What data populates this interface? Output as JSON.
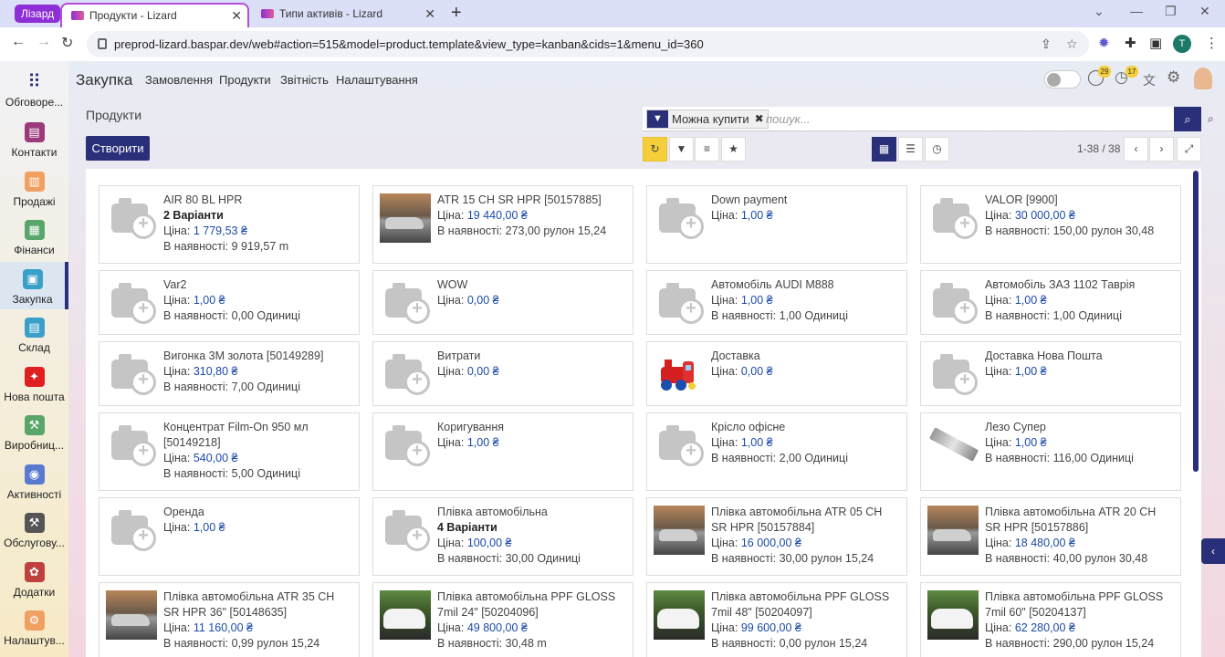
{
  "browser": {
    "profile": "Лізард",
    "tabs": [
      {
        "title": "Продукти - Lizard",
        "active": true
      },
      {
        "title": "Типи активів - Lizard",
        "active": false
      }
    ],
    "url": "preprod-lizard.baspar.dev/web#action=515&model=product.template&view_type=kanban&cids=1&menu_id=360",
    "avatar_letter": "T"
  },
  "sidebar": {
    "items": [
      {
        "label": "Обговоре...",
        "icon": "apps-grid-icon",
        "color": "#2a2f7a"
      },
      {
        "label": "Контакти",
        "icon": "contacts-icon",
        "color": "#9b3a7a"
      },
      {
        "label": "Продажі",
        "icon": "sales-icon",
        "color": "#f0a060"
      },
      {
        "label": "Фінанси",
        "icon": "finance-icon",
        "color": "#5aa66a"
      },
      {
        "label": "Закупка",
        "icon": "purchase-icon",
        "color": "#3aa0c8"
      },
      {
        "label": "Склад",
        "icon": "warehouse-icon",
        "color": "#3aa0c8"
      },
      {
        "label": "Нова пошта",
        "icon": "nova-poshta-icon",
        "color": "#e02020"
      },
      {
        "label": "Виробниц...",
        "icon": "manufacturing-icon",
        "color": "#5aa66a"
      },
      {
        "label": "Активності",
        "icon": "activities-icon",
        "color": "#5a7ad0"
      },
      {
        "label": "Обслугову...",
        "icon": "maintenance-icon",
        "color": "#555"
      },
      {
        "label": "Додатки",
        "icon": "apps-icon",
        "color": "#c04040"
      },
      {
        "label": "Налаштув...",
        "icon": "settings-icon",
        "color": "#f0a060"
      }
    ]
  },
  "topnav": {
    "app_title": "Закупка",
    "menu": [
      "Замовлення",
      "Продукти",
      "Звітність",
      "Налаштування"
    ],
    "chat_badge": "29",
    "activity_badge": "17"
  },
  "page": {
    "title": "Продукти",
    "create_label": "Створити",
    "search": {
      "facet": "Можна купити",
      "placeholder": "пошук..."
    },
    "pager": "1-38 / 38"
  },
  "products": [
    {
      "name": "AIR 80 BL HPR",
      "variants": "2 Варіанти",
      "price_label": "Ціна:",
      "price": "1 779,53 ₴",
      "stock": "В наявності: 9 919,57 m",
      "image": "placeholder"
    },
    {
      "name": "ATR 15 CH SR HPR [50157885]",
      "price_label": "Ціна:",
      "price": "19 440,00 ₴",
      "stock": "В наявності: 273,00 рулон 15,24",
      "image": "car-dark"
    },
    {
      "name": "Down payment",
      "price_label": "Ціна:",
      "price": "1,00 ₴",
      "image": "placeholder"
    },
    {
      "name": "VALOR [9900]",
      "price_label": "Ціна:",
      "price": "30 000,00 ₴",
      "stock": "В наявності: 150,00 рулон 30,48",
      "image": "placeholder"
    },
    {
      "name": "Var2",
      "price_label": "Ціна:",
      "price": "1,00 ₴",
      "stock": "В наявності: 0,00 Одиниці",
      "image": "placeholder"
    },
    {
      "name": "WOW",
      "price_label": "Ціна:",
      "price": "0,00 ₴",
      "image": "placeholder"
    },
    {
      "name": "Автомобіль AUDI M888",
      "price_label": "Ціна:",
      "price": "1,00 ₴",
      "stock": "В наявності: 1,00 Одиниці",
      "image": "placeholder"
    },
    {
      "name": "Автомобіль ЗАЗ 1102 Таврія",
      "price_label": "Ціна:",
      "price": "1,00 ₴",
      "stock": "В наявності: 1,00 Одиниці",
      "image": "placeholder"
    },
    {
      "name": "Вигонка 3М золота [50149289]",
      "price_label": "Ціна:",
      "price": "310,80 ₴",
      "stock": "В наявності: 7,00 Одиниці",
      "image": "placeholder"
    },
    {
      "name": "Витрати",
      "price_label": "Ціна:",
      "price": "0,00 ₴",
      "image": "placeholder"
    },
    {
      "name": "Доставка",
      "price_label": "Ціна:",
      "price": "0,00 ₴",
      "image": "train"
    },
    {
      "name": "Доставка Нова Пошта",
      "price_label": "Ціна:",
      "price": "1,00 ₴",
      "image": "placeholder"
    },
    {
      "name": "Концентрат Film-On 950 мл [50149218]",
      "price_label": "Ціна:",
      "price": "540,00 ₴",
      "stock": "В наявності: 5,00 Одиниці",
      "image": "placeholder"
    },
    {
      "name": "Коригування",
      "price_label": "Ціна:",
      "price": "1,00 ₴",
      "image": "placeholder"
    },
    {
      "name": "Крісло офісне",
      "price_label": "Ціна:",
      "price": "1,00 ₴",
      "stock": "В наявності: 2,00 Одиниці",
      "image": "placeholder"
    },
    {
      "name": "Лезо Супер",
      "price_label": "Ціна:",
      "price": "1,00 ₴",
      "stock": "В наявності: 116,00 Одиниці",
      "image": "blade"
    },
    {
      "name": "Оренда",
      "price_label": "Ціна:",
      "price": "1,00 ₴",
      "image": "placeholder"
    },
    {
      "name": "Плівка автомобільна",
      "variants": "4 Варіанти",
      "price_label": "Ціна:",
      "price": "100,00 ₴",
      "stock": "В наявності: 30,00 Одиниці",
      "image": "placeholder"
    },
    {
      "name": "Плівка автомобільна ATR 05 CH SR HPR [50157884]",
      "price_label": "Ціна:",
      "price": "16 000,00 ₴",
      "stock": "В наявності: 30,00 рулон 15,24",
      "image": "car-dark"
    },
    {
      "name": "Плівка автомобільна ATR 20 CH SR HPR [50157886]",
      "price_label": "Ціна:",
      "price": "18 480,00 ₴",
      "stock": "В наявності: 40,00 рулон 30,48",
      "image": "car-dark"
    },
    {
      "name": "Плівка автомобільна ATR 35 CH SR HPR 36\" [50148635]",
      "price_label": "Ціна:",
      "price": "11 160,00 ₴",
      "stock": "В наявності: 0,99 рулон 15,24",
      "image": "car-dark"
    },
    {
      "name": "Плівка автомобільна PPF GLOSS 7mil 24\" [50204096]",
      "price_label": "Ціна:",
      "price": "49 800,00 ₴",
      "stock": "В наявності: 30,48 m",
      "image": "car-white"
    },
    {
      "name": "Плівка автомобільна PPF GLOSS 7mil 48\" [50204097]",
      "price_label": "Ціна:",
      "price": "99 600,00 ₴",
      "stock": "В наявності: 0,00 рулон 15,24",
      "image": "car-white"
    },
    {
      "name": "Плівка автомобільна PPF GLOSS 7mil 60\" [50204137]",
      "price_label": "Ціна:",
      "price": "62 280,00 ₴",
      "stock": "В наявності: 290,00 рулон 15,24",
      "image": "car-white"
    }
  ]
}
